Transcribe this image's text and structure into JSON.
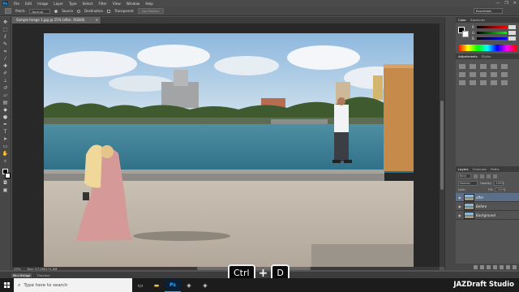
{
  "menubar": {
    "logo": "Ps",
    "items": [
      "File",
      "Edit",
      "Image",
      "Layer",
      "Type",
      "Select",
      "Filter",
      "View",
      "Window",
      "Help"
    ],
    "window_controls": [
      "—",
      "❐",
      "✕"
    ]
  },
  "options": {
    "patch_label": "Patch:",
    "patch_mode": "Normal",
    "source_label": "Source",
    "destination_label": "Destination",
    "transparent_label": "Transparent",
    "use_pattern_label": "Use Pattern",
    "workspace": "Essentials"
  },
  "document": {
    "tab_title": "Sample Image 1.jpg @ 25% (after, RGB/8)",
    "close": "×"
  },
  "status": {
    "zoom": "25%",
    "doc_size": "Doc: 57.2M/171.0M"
  },
  "bottom_tabs": [
    "Mini Bridge",
    "Timeline"
  ],
  "color_panel": {
    "tabs": [
      "Color",
      "Swatches"
    ],
    "channels": [
      "R",
      "G",
      "B"
    ]
  },
  "adjust_panel": {
    "tabs": [
      "Adjustments",
      "Styles"
    ]
  },
  "layers_panel": {
    "tabs": [
      "Layers",
      "Channels",
      "Paths"
    ],
    "kind": "Kind",
    "blend_mode": "Normal",
    "opacity_label": "Opacity:",
    "opacity": "100%",
    "lock_label": "Lock:",
    "fill_label": "Fill:",
    "fill": "100%",
    "layers": [
      {
        "name": "after",
        "selected": true
      },
      {
        "name": "Before",
        "selected": false
      },
      {
        "name": "Background",
        "selected": false
      }
    ]
  },
  "hotkey": {
    "key1": "Ctrl",
    "plus": "+",
    "key2": "D"
  },
  "taskbar": {
    "search_placeholder": "Type here to search"
  },
  "watermark": "JAZDraft Studio",
  "colors": {
    "ps_blue": "#31a8ff",
    "layer_selected": "#5b6f8a",
    "canvas_bg": "#282828"
  }
}
